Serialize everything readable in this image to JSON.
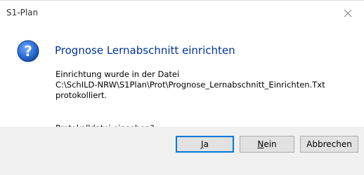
{
  "window": {
    "title": "S1-Plan"
  },
  "dialog": {
    "instruction": "Prognose Lernabschnitt einrichten",
    "body_lines": [
      "Einrichtung wurde in der Datei",
      "C:\\SchILD-NRW\\S1Plan\\Prot\\Prognose_Lernabschnitt_Einrichten.Txt",
      "protokolliert."
    ],
    "question": "Protokolldatei einsehen?",
    "icon": "question-icon"
  },
  "buttons": {
    "yes_access": "J",
    "yes_rest": "a",
    "no_access": "N",
    "no_rest": "ein",
    "cancel": "Abbrechen"
  },
  "colors": {
    "instruction": "#003399",
    "footer_bg": "#f0f0f0",
    "default_button_border": "#0078d7",
    "icon_blue": "#1f5fbf"
  }
}
